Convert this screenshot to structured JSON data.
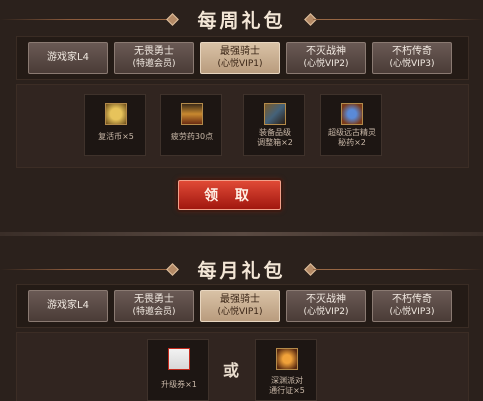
{
  "weekly": {
    "title": "每周礼包",
    "tabs": [
      {
        "label": "游戏家L4",
        "sub": ""
      },
      {
        "label": "无畏勇士",
        "sub": "(特邀会员)"
      },
      {
        "label": "最强骑士",
        "sub": "(心悦VIP1)"
      },
      {
        "label": "不灭战神",
        "sub": "(心悦VIP2)"
      },
      {
        "label": "不朽传奇",
        "sub": "(心悦VIP3)"
      }
    ],
    "active_tab": 2,
    "items": [
      {
        "label": "复活币×5",
        "icon": "coin-icon"
      },
      {
        "label": "疲劳药30点",
        "icon": "potion-icon"
      },
      {
        "label": "装备品级\n调整箱×2",
        "icon": "box-icon"
      },
      {
        "label": "超级远古精灵\n秘药×2",
        "icon": "elixir-icon"
      }
    ],
    "claim_label": "领 取"
  },
  "monthly": {
    "title": "每月礼包",
    "tabs": [
      {
        "label": "游戏家L4",
        "sub": ""
      },
      {
        "label": "无畏勇士",
        "sub": "(特邀会员)"
      },
      {
        "label": "最强骑士",
        "sub": "(心悦VIP1)"
      },
      {
        "label": "不灭战神",
        "sub": "(心悦VIP2)"
      },
      {
        "label": "不朽传奇",
        "sub": "(心悦VIP3)"
      }
    ],
    "active_tab": 2,
    "items": [
      {
        "label": "升级券×1",
        "icon": "ticket-icon"
      },
      {
        "label": "深渊派对\n通行证×5",
        "icon": "pass-icon"
      }
    ],
    "or_text": "或"
  },
  "colors": {
    "accent_red": "#c22a1d",
    "active_tab": "#c8ae90",
    "background": "#2b211c"
  }
}
